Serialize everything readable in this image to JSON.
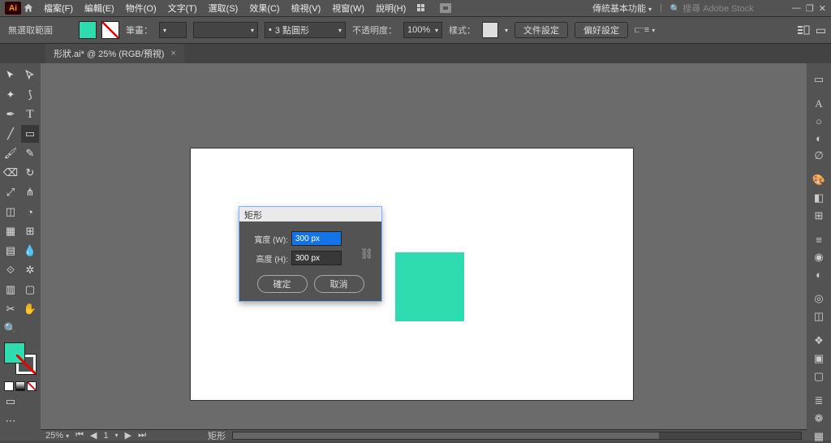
{
  "menu": {
    "items": [
      "檔案(F)",
      "編輯(E)",
      "物件(O)",
      "文字(T)",
      "選取(S)",
      "效果(C)",
      "檢視(V)",
      "視窗(W)",
      "說明(H)"
    ],
    "workspace": "傳統基本功能",
    "search_placeholder": "搜尋 Adobe Stock"
  },
  "controlbar": {
    "no_selection": "無選取範圍",
    "brush_label": "筆畫：",
    "stroke_value": "",
    "stroke_profile_value": "3 點圓形",
    "opacity_label": "不透明度：",
    "opacity_value": "100%",
    "style_label": "樣式：",
    "doc_setup": "文件設定",
    "pref": "偏好設定"
  },
  "document": {
    "tab_title": "形狀.ai* @ 25% (RGB/預視)"
  },
  "dialog": {
    "title": "矩形",
    "width_label": "寬度 (W):",
    "width_value": "300 px",
    "height_label": "高度 (H):",
    "height_value": "300 px",
    "ok": "確定",
    "cancel": "取消"
  },
  "status": {
    "zoom": "25%",
    "artboard_nav": "1",
    "tool": "矩形"
  },
  "colors": {
    "fill": "#2fdcb0"
  }
}
